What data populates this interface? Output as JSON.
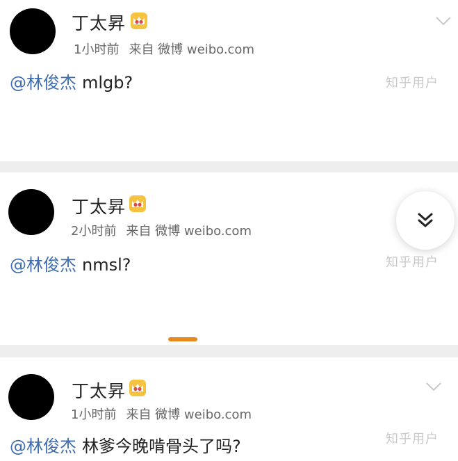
{
  "posts": [
    {
      "username": "丁太昇",
      "time": "1小时前",
      "source": "来自 微博 weibo.com",
      "mention": "@林俊杰",
      "text": "mlgb?",
      "watermark": "知乎用户"
    },
    {
      "username": "丁太昇",
      "time": "2小时前",
      "source": "来自 微博 weibo.com",
      "mention": "@林俊杰",
      "text": "nmsl?",
      "watermark": "知乎用户"
    },
    {
      "username": "丁太昇",
      "time": "1小时前",
      "source": "来自 微博 weibo.com",
      "mention": "@林俊杰",
      "text": "林爹今晚啃骨头了吗?",
      "watermark": "知乎用户"
    }
  ],
  "icons": {
    "badge": "crown-badge-icon",
    "menu": "chevron-down-icon",
    "scroll": "double-chevron-down-icon"
  },
  "colors": {
    "mention": "#3d6cb0",
    "accent": "#e8891e",
    "separator": "#eeeeee"
  }
}
